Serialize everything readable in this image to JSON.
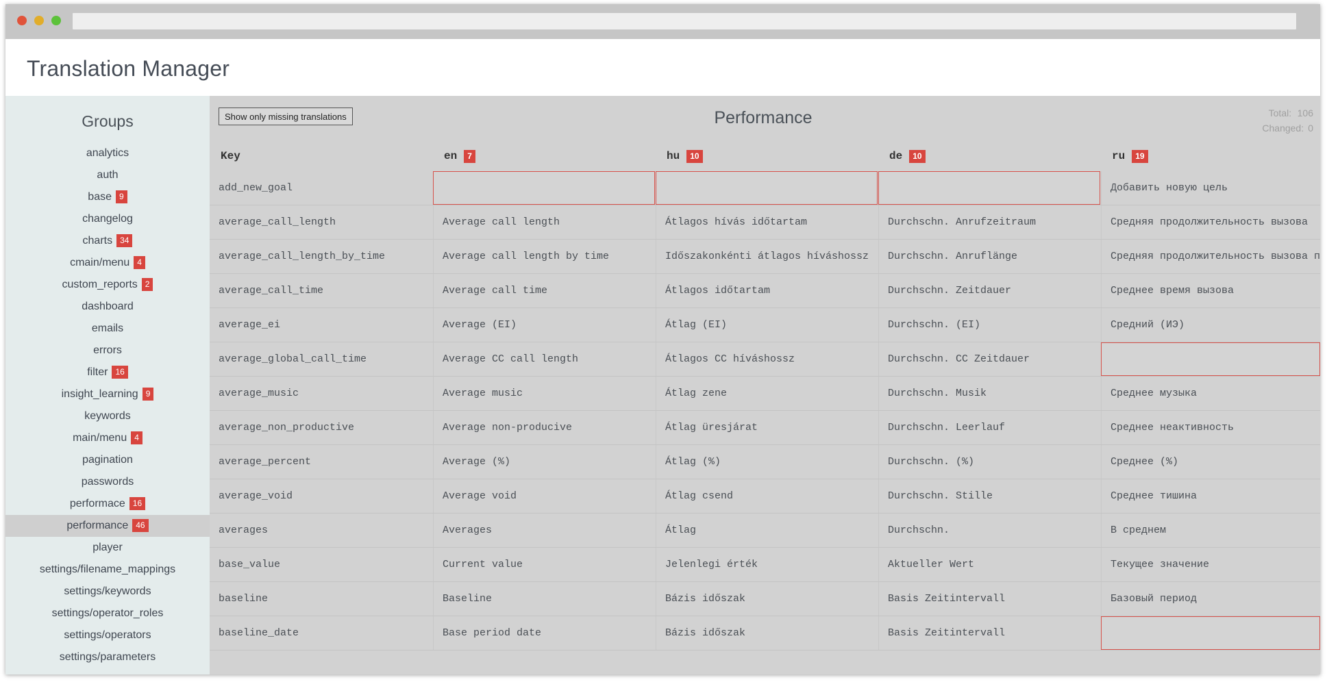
{
  "app": {
    "title": "Translation Manager"
  },
  "sidebar": {
    "heading": "Groups",
    "items": [
      {
        "label": "analytics",
        "badge": null
      },
      {
        "label": "auth",
        "badge": null
      },
      {
        "label": "base",
        "badge": "9"
      },
      {
        "label": "changelog",
        "badge": null
      },
      {
        "label": "charts",
        "badge": "34"
      },
      {
        "label": "cmain/menu",
        "badge": "4"
      },
      {
        "label": "custom_reports",
        "badge": "2"
      },
      {
        "label": "dashboard",
        "badge": null
      },
      {
        "label": "emails",
        "badge": null
      },
      {
        "label": "errors",
        "badge": null
      },
      {
        "label": "filter",
        "badge": "16"
      },
      {
        "label": "insight_learning",
        "badge": "9"
      },
      {
        "label": "keywords",
        "badge": null
      },
      {
        "label": "main/menu",
        "badge": "4"
      },
      {
        "label": "pagination",
        "badge": null
      },
      {
        "label": "passwords",
        "badge": null
      },
      {
        "label": "performace",
        "badge": "16"
      },
      {
        "label": "performance",
        "badge": "46",
        "active": true
      },
      {
        "label": "player",
        "badge": null
      },
      {
        "label": "settings/filename_mappings",
        "badge": null
      },
      {
        "label": "settings/keywords",
        "badge": null
      },
      {
        "label": "settings/operator_roles",
        "badge": null
      },
      {
        "label": "settings/operators",
        "badge": null
      },
      {
        "label": "settings/parameters",
        "badge": null
      }
    ]
  },
  "main": {
    "show_missing_label": "Show only missing translations",
    "title": "Performance",
    "stats": {
      "total_label": "Total:",
      "total": "106",
      "changed_label": "Changed:",
      "changed": "0"
    },
    "columns": [
      {
        "label": "Key",
        "badge": null
      },
      {
        "label": "en",
        "badge": "7"
      },
      {
        "label": "hu",
        "badge": "10"
      },
      {
        "label": "de",
        "badge": "10"
      },
      {
        "label": "ru",
        "badge": "19"
      }
    ],
    "rows": [
      {
        "key": "add_new_goal",
        "en": "",
        "hu": "",
        "de": "",
        "ru": "Добавить новую цель"
      },
      {
        "key": "average_call_length",
        "en": "Average call length",
        "hu": "Átlagos hívás időtartam",
        "de": "Durchschn. Anrufzeitraum",
        "ru": "Средняя продолжительность вызова"
      },
      {
        "key": "average_call_length_by_time",
        "en": "Average call length by time",
        "hu": "Időszakonkénti átlagos híváshossz",
        "de": "Durchschn. Anruflänge",
        "ru": "Средняя продолжительность вызова по"
      },
      {
        "key": "average_call_time",
        "en": "Average call time",
        "hu": "Átlagos időtartam",
        "de": "Durchschn. Zeitdauer",
        "ru": "Среднее время вызова"
      },
      {
        "key": "average_ei",
        "en": "Average (EI)",
        "hu": "Átlag (EI)",
        "de": "Durchschn. (EI)",
        "ru": "Средний (ИЭ)"
      },
      {
        "key": "average_global_call_time",
        "en": "Average CC call length",
        "hu": "Átlagos CC híváshossz",
        "de": "Durchschn. CC Zeitdauer",
        "ru": ""
      },
      {
        "key": "average_music",
        "en": "Average music",
        "hu": "Átlag zene",
        "de": "Durchschn. Musik",
        "ru": "Среднее музыка"
      },
      {
        "key": "average_non_productive",
        "en": "Average non-producive",
        "hu": "Átlag üresjárat",
        "de": "Durchschn. Leerlauf",
        "ru": "Среднее неактивность"
      },
      {
        "key": "average_percent",
        "en": "Average (%)",
        "hu": "Átlag (%)",
        "de": "Durchschn. (%)",
        "ru": "Среднее (%)"
      },
      {
        "key": "average_void",
        "en": "Average void",
        "hu": "Átlag csend",
        "de": "Durchschn. Stille",
        "ru": "Среднее тишина"
      },
      {
        "key": "averages",
        "en": "Averages",
        "hu": "Átlag",
        "de": "Durchschn.",
        "ru": "В среднем"
      },
      {
        "key": "base_value",
        "en": "Current value",
        "hu": "Jelenlegi érték",
        "de": "Aktueller Wert",
        "ru": "Текущее значение"
      },
      {
        "key": "baseline",
        "en": "Baseline",
        "hu": "Bázis időszak",
        "de": "Basis Zeitintervall",
        "ru": "Базовый период"
      },
      {
        "key": "baseline_date",
        "en": "Base period date",
        "hu": "Bázis időszak",
        "de": "Basis Zeitintervall",
        "ru": ""
      }
    ]
  }
}
